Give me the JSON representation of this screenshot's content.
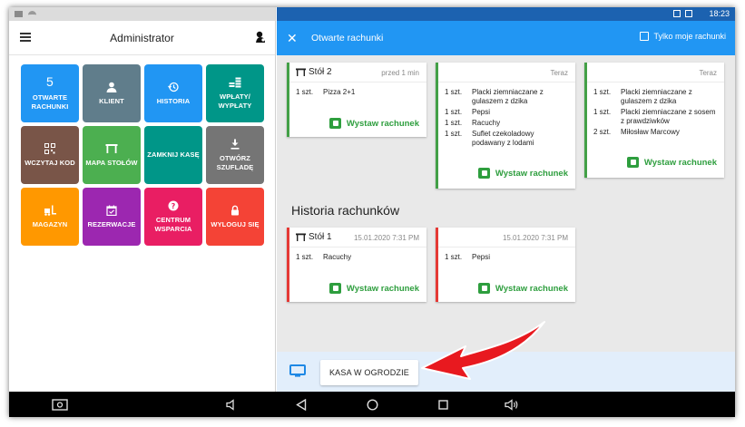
{
  "left_panel": {
    "title": "Administrator",
    "tiles": [
      {
        "label": "OTWARTE RACHUNKI",
        "count": "5",
        "color": "#2196f3",
        "icon": "number"
      },
      {
        "label": "KLIENT",
        "color": "#607d8b",
        "icon": "person-icon"
      },
      {
        "label": "HISTORIA",
        "color": "#2196f3",
        "icon": "history-icon"
      },
      {
        "label": "WPŁATY/ WYPŁATY",
        "color": "#009688",
        "icon": "coins-icon"
      },
      {
        "label": "WCZYTAJ KOD",
        "color": "#795548",
        "icon": "qr-code-icon"
      },
      {
        "label": "MAPA STOŁÓW",
        "color": "#4caf50",
        "icon": "table-icon"
      },
      {
        "label": "ZAMKNIJ KASĘ",
        "color": "#009688",
        "icon": "none"
      },
      {
        "label": "OTWÓRZ SZUFLADĘ",
        "color": "#757575",
        "icon": "download-icon"
      },
      {
        "label": "MAGAZYN",
        "color": "#ff9800",
        "icon": "forklift-icon"
      },
      {
        "label": "REZERWACJE",
        "color": "#9c27b0",
        "icon": "calendar-icon"
      },
      {
        "label": "CENTRUM WSPARCIA",
        "color": "#e91e63",
        "icon": "help-icon"
      },
      {
        "label": "WYLOGUJ SIĘ",
        "color": "#f44336",
        "icon": "lock-icon"
      }
    ]
  },
  "right_panel": {
    "status_time": "18:23",
    "title": "Otwarte rachunki",
    "only_mine_label": "Tylko moje rachunki",
    "open_bills": [
      {
        "table": "Stół 2",
        "when": "przed 1 min",
        "items": [
          {
            "qty": "1 szt.",
            "name": "Pizza 2+1"
          }
        ],
        "action": "Wystaw rachunek"
      },
      {
        "table": "",
        "when": "Teraz",
        "items": [
          {
            "qty": "1 szt.",
            "name": "Placki ziemniaczane z gulaszem z dzika"
          },
          {
            "qty": "1 szt.",
            "name": "Pepsi"
          },
          {
            "qty": "1 szt.",
            "name": "Racuchy"
          },
          {
            "qty": "1 szt.",
            "name": "Suflet czekoladowy podawany z lodami"
          }
        ],
        "action": "Wystaw rachunek"
      },
      {
        "table": "",
        "when": "Teraz",
        "items": [
          {
            "qty": "1 szt.",
            "name": "Placki ziemniaczane z gulaszem z dzika"
          },
          {
            "qty": "1 szt.",
            "name": "Placki ziemniaczane z sosem z prawdziwków"
          },
          {
            "qty": "2 szt.",
            "name": "Miłosław Marcowy"
          }
        ],
        "action": "Wystaw rachunek"
      }
    ],
    "history_title": "Historia rachunków",
    "history_bills": [
      {
        "table": "Stół 1",
        "when": "15.01.2020 7:31 PM",
        "items": [
          {
            "qty": "1 szt.",
            "name": "Racuchy"
          }
        ],
        "action": "Wystaw rachunek"
      },
      {
        "table": "",
        "when": "15.01.2020 7:31 PM",
        "items": [
          {
            "qty": "1 szt.",
            "name": "Pepsi"
          }
        ],
        "action": "Wystaw rachunek"
      }
    ],
    "register_button": "KASA W OGRODZIE"
  }
}
